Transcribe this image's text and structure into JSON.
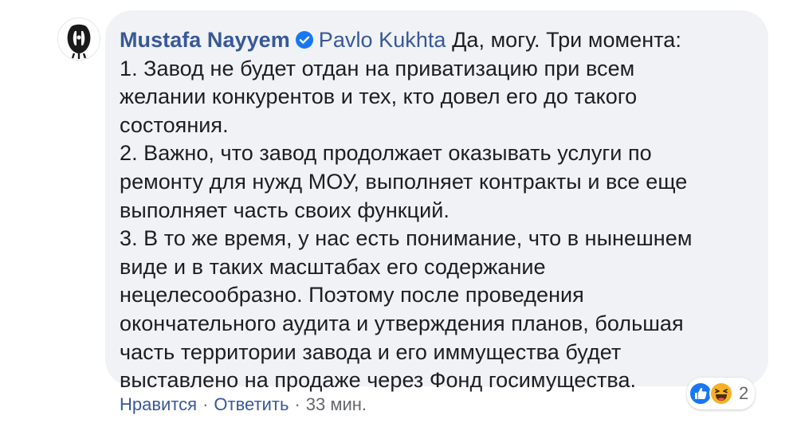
{
  "comment": {
    "author": "Mustafa Nayyem",
    "mention": "Pavlo Kukhta",
    "lines": [
      "Да, могу. Три момента:",
      "1. Завод не будет отдан на приватизацию при всем",
      "желании конкурентов и тех, кто довел его до такого",
      "состояния.",
      "2. Важно, что завод продолжает оказывать услуги по",
      "ремонту для нужд МОУ, выполняет контракты и все еще",
      "выполняет часть своих функций.",
      "3. В то же время, у нас есть понимание, что в нынешнем",
      "виде и в таких масштабах его содержание",
      "нецелесообразно. Поэтому после проведения",
      "окончательного аудита и утверждения планов, большая",
      "часть территории завода и его иммущества будет",
      "выставлено на продаже через Фонд госимущества."
    ]
  },
  "reactions": {
    "icons": [
      "like-icon",
      "haha-icon"
    ],
    "count": "2"
  },
  "actions": {
    "like_label": "Нравится",
    "separator": "·",
    "reply_label": "Ответить",
    "time_label": "33 мин."
  },
  "colors": {
    "bubble_bg": "#f0f2f5",
    "link": "#385898",
    "text": "#1c1e21",
    "meta": "#65676b",
    "like_blue": "#1877f2",
    "haha_yellow": "#f7b125"
  }
}
